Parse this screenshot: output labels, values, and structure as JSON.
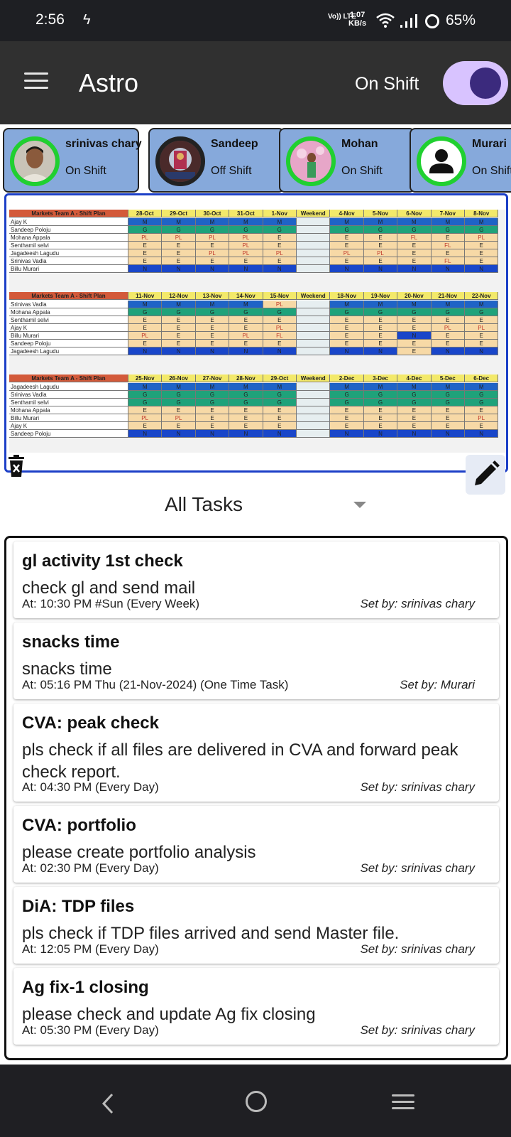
{
  "status_bar": {
    "time": "2:56",
    "network_type": "Vo)) LTE",
    "speed_value": "1.07",
    "speed_unit": "KB/s",
    "battery": "65%"
  },
  "app_bar": {
    "title": "Astro",
    "shift_label": "On Shift",
    "shift_on": true
  },
  "members": [
    {
      "name": "srinivas chary",
      "status": "On Shift",
      "avatar": "photo"
    },
    {
      "name": "Sandeep",
      "status": "Off Shift",
      "avatar": "photo"
    },
    {
      "name": "Mohan",
      "status": "On Shift",
      "avatar": "photo"
    },
    {
      "name": "Murari",
      "status": "On Shift",
      "avatar": "person-icon"
    }
  ],
  "schedule": {
    "blocks": [
      {
        "header": "Markets Team A - Shift Plan",
        "dates": [
          "28-Oct",
          "29-Oct",
          "30-Oct",
          "31-Oct",
          "1-Nov",
          "Weekend",
          "4-Nov",
          "5-Nov",
          "6-Nov",
          "7-Nov",
          "8-Nov"
        ],
        "rows": [
          {
            "name": "Ajay K",
            "cells": [
              "M",
              "M",
              "M",
              "M",
              "M",
              "",
              "M",
              "M",
              "M",
              "M",
              "M"
            ]
          },
          {
            "name": "Sandeep Poloju",
            "cells": [
              "G",
              "G",
              "G",
              "G",
              "G",
              "",
              "G",
              "G",
              "G",
              "G",
              "G"
            ]
          },
          {
            "name": "Mohana Appala",
            "cells": [
              "PL",
              "PL",
              "PL",
              "PL",
              "E",
              "",
              "E",
              "E",
              "FL",
              "E",
              "PL"
            ]
          },
          {
            "name": "Senthamil selvi",
            "cells": [
              "E",
              "E",
              "E",
              "PL",
              "E",
              "",
              "E",
              "E",
              "E",
              "FL",
              "E"
            ]
          },
          {
            "name": "Jagadeesh Lagudu",
            "cells": [
              "E",
              "E",
              "PL",
              "PL",
              "PL",
              "",
              "PL",
              "PL",
              "E",
              "E",
              "E"
            ]
          },
          {
            "name": "Srinivas Vadla",
            "cells": [
              "E",
              "E",
              "E",
              "E",
              "E",
              "",
              "E",
              "E",
              "E",
              "FL",
              "E"
            ]
          },
          {
            "name": "Billu Murari",
            "cells": [
              "N",
              "N",
              "N",
              "N",
              "N",
              "",
              "N",
              "N",
              "N",
              "N",
              "N"
            ]
          }
        ]
      },
      {
        "header": "Markets Team A - Shift Plan",
        "dates": [
          "11-Nov",
          "12-Nov",
          "13-Nov",
          "14-Nov",
          "15-Nov",
          "Weekend",
          "18-Nov",
          "19-Nov",
          "20-Nov",
          "21-Nov",
          "22-Nov"
        ],
        "rows": [
          {
            "name": "Srinivas Vadla",
            "cells": [
              "M",
              "M",
              "M",
              "M",
              "PL",
              "",
              "M",
              "M",
              "M",
              "M",
              "M"
            ]
          },
          {
            "name": "Mohana Appala",
            "cells": [
              "G",
              "G",
              "G",
              "G",
              "G",
              "",
              "G",
              "G",
              "G",
              "G",
              "G"
            ]
          },
          {
            "name": "Senthamil selvi",
            "cells": [
              "E",
              "E",
              "E",
              "E",
              "E",
              "",
              "E",
              "E",
              "E",
              "E",
              "E"
            ]
          },
          {
            "name": "Ajay K",
            "cells": [
              "E",
              "E",
              "E",
              "E",
              "PL",
              "",
              "E",
              "E",
              "E",
              "PL",
              "PL"
            ]
          },
          {
            "name": "Billu Murari",
            "cells": [
              "PL",
              "E",
              "E",
              "PL",
              "FL",
              "",
              "E",
              "E",
              "N",
              "E",
              "E"
            ]
          },
          {
            "name": "Sandeep Poloju",
            "cells": [
              "E",
              "E",
              "E",
              "E",
              "E",
              "",
              "E",
              "E",
              "E",
              "E",
              "E"
            ]
          },
          {
            "name": "Jagadeesh Lagudu",
            "cells": [
              "N",
              "N",
              "N",
              "N",
              "N",
              "",
              "N",
              "N",
              "E",
              "N",
              "N"
            ]
          }
        ]
      },
      {
        "header": "Markets Team A - Shift Plan",
        "dates": [
          "25-Nov",
          "26-Nov",
          "27-Nov",
          "28-Nov",
          "29-Oct",
          "Weekend",
          "2-Dec",
          "3-Dec",
          "4-Dec",
          "5-Dec",
          "6-Dec"
        ],
        "rows": [
          {
            "name": "Jagadeesh Lagudu",
            "cells": [
              "M",
              "M",
              "M",
              "M",
              "M",
              "",
              "M",
              "M",
              "M",
              "M",
              "M"
            ]
          },
          {
            "name": "Srinivas Vadla",
            "cells": [
              "G",
              "G",
              "G",
              "G",
              "G",
              "",
              "G",
              "G",
              "G",
              "G",
              "G"
            ]
          },
          {
            "name": "Senthamil selvi",
            "cells": [
              "G",
              "G",
              "G",
              "G",
              "G",
              "",
              "G",
              "G",
              "G",
              "G",
              "G"
            ]
          },
          {
            "name": "Mohana Appala",
            "cells": [
              "E",
              "E",
              "E",
              "E",
              "E",
              "",
              "E",
              "E",
              "E",
              "E",
              "E"
            ]
          },
          {
            "name": "Billu Murari",
            "cells": [
              "PL",
              "PL",
              "E",
              "E",
              "E",
              "",
              "E",
              "E",
              "E",
              "E",
              "PL"
            ]
          },
          {
            "name": "Ajay K",
            "cells": [
              "E",
              "E",
              "E",
              "E",
              "E",
              "",
              "E",
              "E",
              "E",
              "E",
              "E"
            ]
          },
          {
            "name": "Sandeep Poloju",
            "cells": [
              "N",
              "N",
              "N",
              "N",
              "N",
              "",
              "N",
              "N",
              "N",
              "N",
              "N"
            ]
          }
        ]
      }
    ]
  },
  "filter": {
    "label": "All Tasks"
  },
  "tasks": [
    {
      "title": "gl activity 1st check",
      "description": "check gl and send mail",
      "at": "At: 10:30 PM #Sun (Every Week)",
      "set_by": "Set by: srinivas chary"
    },
    {
      "title": "snacks time",
      "description": "snacks time",
      "at": "At: 05:16 PM Thu (21-Nov-2024) (One Time Task)",
      "set_by": "Set by: Murari"
    },
    {
      "title": "CVA: peak check",
      "description": "pls check if all files are delivered in CVA and forward peak check report.",
      "at": "At: 04:30 PM (Every Day)",
      "set_by": "Set by: srinivas chary"
    },
    {
      "title": "CVA: portfolio",
      "description": "please create portfolio analysis",
      "at": "At: 02:30 PM (Every Day)",
      "set_by": "Set by: srinivas chary"
    },
    {
      "title": "DiA: TDP files",
      "description": "pls check if TDP files arrived and send Master file.",
      "at": "At: 12:05 PM (Every Day)",
      "set_by": "Set by: srinivas chary"
    },
    {
      "title": "Ag fix-1 closing",
      "description": "please check and update Ag fix closing",
      "at": "At: 05:30 PM (Every Day)",
      "set_by": "Set by: srinivas chary"
    }
  ],
  "colors": {
    "app_bar": "#303030",
    "member_card": "#86a9db",
    "on_shift_ring": "#20d030",
    "toggle_track": "#d8c3ff",
    "toggle_knob": "#3b2a7d",
    "schedule_border": "#1c3fc7",
    "shift_M": "#1f63c6",
    "shift_G": "#1fa27a",
    "shift_E": "#f7d9a6",
    "shift_N": "#1946c9",
    "shift_PL": "#f7d9a6",
    "shift_FL": "#f7d9a6",
    "header_yellow": "#f3e96a",
    "header_red": "#d35a3a"
  },
  "icons": {
    "menu": "menu-icon",
    "delete": "trash-icon",
    "edit": "pencil-icon",
    "dropdown": "caret-down-icon",
    "back": "back-icon",
    "home": "home-icon",
    "recents": "recents-icon"
  }
}
